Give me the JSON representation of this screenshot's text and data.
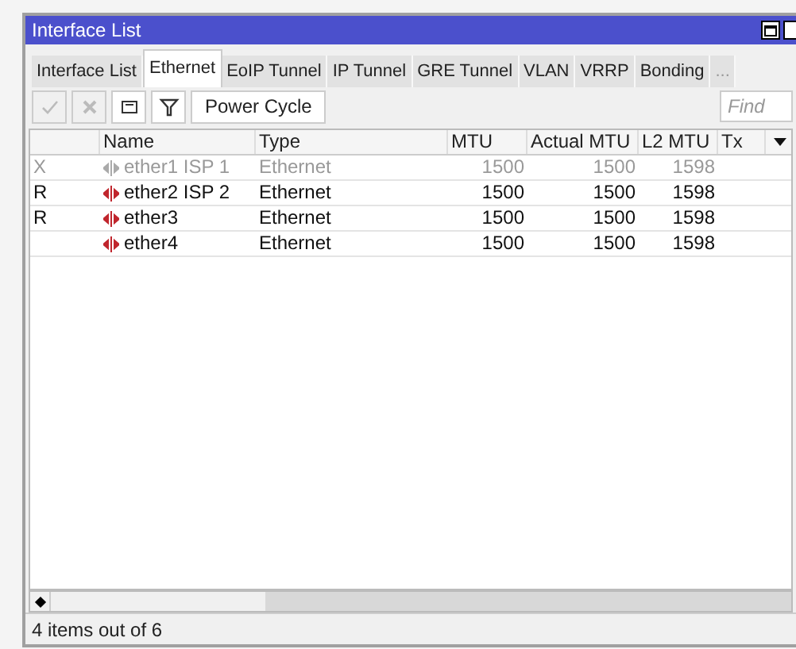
{
  "window": {
    "title": "Interface List"
  },
  "tabs": [
    {
      "label": "Interface List",
      "selected": false
    },
    {
      "label": "Ethernet",
      "selected": true
    },
    {
      "label": "EoIP Tunnel",
      "selected": false
    },
    {
      "label": "IP Tunnel",
      "selected": false
    },
    {
      "label": "GRE Tunnel",
      "selected": false
    },
    {
      "label": "VLAN",
      "selected": false
    },
    {
      "label": "VRRP",
      "selected": false
    },
    {
      "label": "Bonding",
      "selected": false
    },
    {
      "label": "...",
      "selected": false
    }
  ],
  "toolbar": {
    "buttons": [
      {
        "kind": "check",
        "disabled": true
      },
      {
        "kind": "cross",
        "disabled": true
      },
      {
        "kind": "comment",
        "disabled": false
      },
      {
        "kind": "filter",
        "disabled": false
      }
    ],
    "power_cycle": "Power Cycle",
    "search": {
      "placeholder": "Find"
    }
  },
  "table": {
    "columns": [
      "Name",
      "Type",
      "MTU",
      "Actual MTU",
      "L2 MTU",
      "Tx"
    ],
    "rows": [
      {
        "flag": "X",
        "name": "ether1 ISP 1",
        "type": "Ethernet",
        "mtu": "1500",
        "actual_mtu": "1500",
        "l2_mtu": "1598",
        "disabled": true
      },
      {
        "flag": "R",
        "name": "ether2 ISP 2",
        "type": "Ethernet",
        "mtu": "1500",
        "actual_mtu": "1500",
        "l2_mtu": "1598",
        "disabled": false
      },
      {
        "flag": "R",
        "name": "ether3",
        "type": "Ethernet",
        "mtu": "1500",
        "actual_mtu": "1500",
        "l2_mtu": "1598",
        "disabled": false
      },
      {
        "flag": "",
        "name": "ether4",
        "type": "Ethernet",
        "mtu": "1500",
        "actual_mtu": "1500",
        "l2_mtu": "1598",
        "disabled": false
      }
    ]
  },
  "status_bar": "4 items out of 6"
}
